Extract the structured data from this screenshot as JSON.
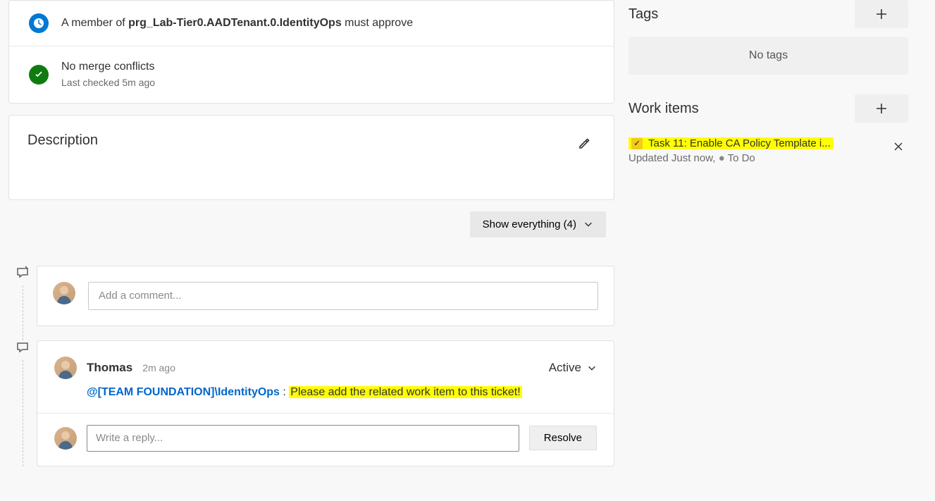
{
  "checks": {
    "approval": {
      "prefix": "A member of ",
      "group": "prg_Lab-Tier0.AADTenant.0.IdentityOps",
      "suffix": " must approve"
    },
    "merge": {
      "title": "No merge conflicts",
      "subtitle": "Last checked 5m ago"
    }
  },
  "description": {
    "heading": "Description"
  },
  "activity": {
    "show_label": "Show everything (4)",
    "add_comment_placeholder": "Add a comment..."
  },
  "comment": {
    "author": "Thomas",
    "time": "2m ago",
    "status": "Active",
    "mention": "@[TEAM FOUNDATION]\\IdentityOps",
    "separator": " : ",
    "text": "Please add the related work item to this ticket!",
    "reply_placeholder": "Write a reply...",
    "resolve_label": "Resolve"
  },
  "sidebar": {
    "tags": {
      "heading": "Tags",
      "empty": "No tags"
    },
    "workitems": {
      "heading": "Work items",
      "item": {
        "title": "Task 11: Enable CA Policy Template i...",
        "updated": "Updated Just now,",
        "state": "To Do"
      }
    }
  }
}
